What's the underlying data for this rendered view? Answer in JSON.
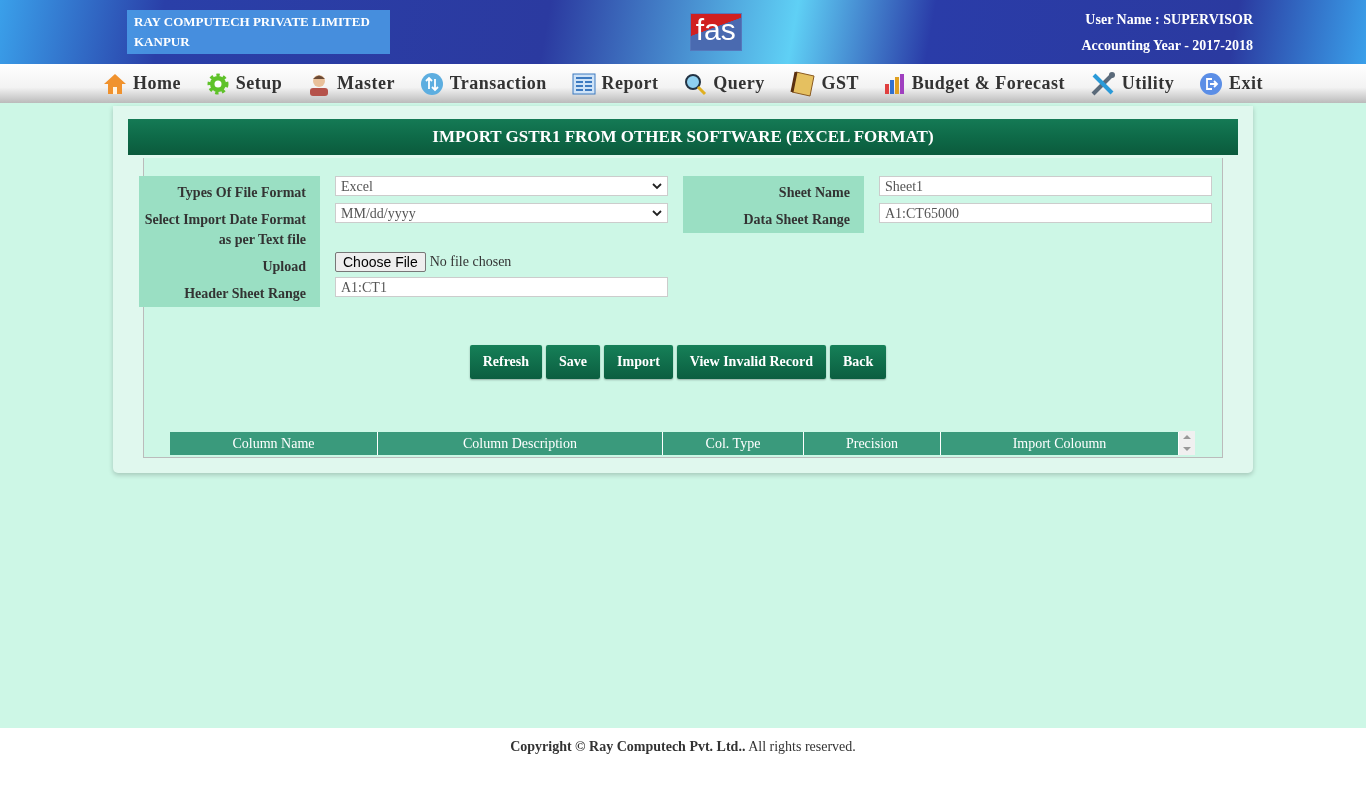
{
  "header": {
    "company": "RAY COMPUTECH PRIVATE LIMITED",
    "city": "KANPUR",
    "logo": "fas",
    "user": "User Name : SUPERVISOR",
    "year": "Accounting Year - 2017-2018"
  },
  "menu": [
    {
      "label": "Home"
    },
    {
      "label": "Setup"
    },
    {
      "label": "Master"
    },
    {
      "label": "Transaction"
    },
    {
      "label": "Report"
    },
    {
      "label": "Query"
    },
    {
      "label": "GST"
    },
    {
      "label": "Budget & Forecast"
    },
    {
      "label": "Utility"
    },
    {
      "label": "Exit"
    }
  ],
  "page_title": "IMPORT GSTR1 FROM OTHER SOFTWARE (EXCEL FORMAT)",
  "left_fields": [
    {
      "kind": "dropdown",
      "label": "Types Of File Format",
      "value": "Excel"
    },
    {
      "kind": "dropdown",
      "label": "Select Import Date Format as per Text file",
      "value": "MM/dd/yyyy"
    },
    {
      "kind": "file",
      "label": "Upload",
      "button": "Choose File",
      "value": "No file chosen"
    },
    {
      "kind": "text",
      "label": "Header Sheet Range",
      "value": "A1:CT1"
    }
  ],
  "right_fields": [
    {
      "kind": "text",
      "label": "Sheet Name",
      "value": "Sheet1"
    },
    {
      "kind": "text",
      "label": "Data Sheet Range",
      "value": "A1:CT65000"
    }
  ],
  "buttons": [
    "Refresh",
    "Save",
    "Import",
    "View Invalid Record",
    "Back"
  ],
  "table": {
    "columns": [
      "Column Name",
      "Column Description",
      "Col. Type",
      "Precision",
      "Import Coloumn"
    ]
  },
  "footer": "**Copyright © Ray Computech Pvt. Ltd..** All rights reserved."
}
